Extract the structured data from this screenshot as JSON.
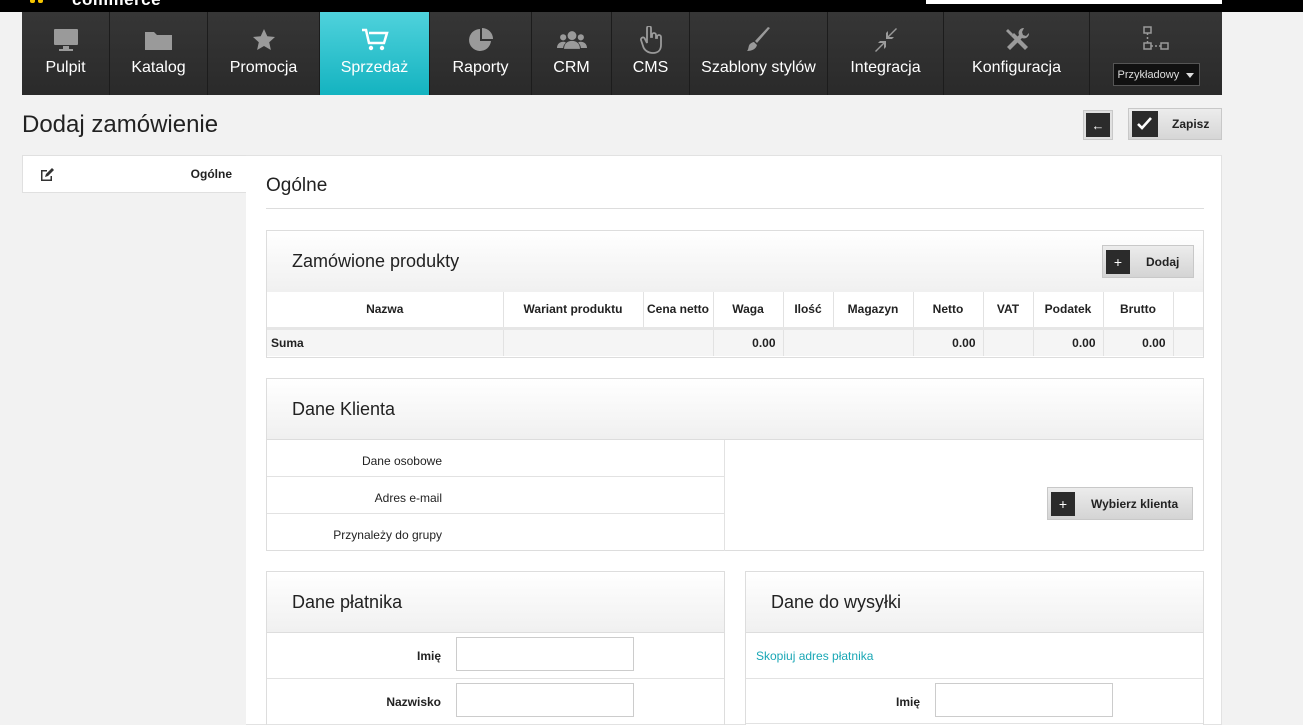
{
  "brand": {
    "text": "commerce",
    "accent": "#f5c400"
  },
  "nav": {
    "items": [
      {
        "label": "Pulpit",
        "icon": "monitor-icon"
      },
      {
        "label": "Katalog",
        "icon": "folder-icon"
      },
      {
        "label": "Promocja",
        "icon": "star-icon"
      },
      {
        "label": "Sprzedaż",
        "icon": "cart-icon",
        "active": true
      },
      {
        "label": "Raporty",
        "icon": "pie-chart-icon"
      },
      {
        "label": "CRM",
        "icon": "users-icon"
      },
      {
        "label": "CMS",
        "icon": "pointer-hand-icon"
      },
      {
        "label": "Szablony stylów",
        "icon": "brush-icon"
      },
      {
        "label": "Integracja",
        "icon": "compress-arrows-icon"
      },
      {
        "label": "Konfiguracja",
        "icon": "tools-icon"
      }
    ],
    "store_select": {
      "value": "Przykładowy",
      "icon": "sitemap-icon"
    },
    "active_color": "#1fb7c3"
  },
  "header": {
    "title": "Dodaj zamówienie",
    "back_icon": "arrow-left-icon",
    "save_label": "Zapisz"
  },
  "sidebar": {
    "tabs": [
      {
        "label": "Ogólne",
        "icon": "edit-icon"
      }
    ]
  },
  "main": {
    "section_title": "Ogólne",
    "products": {
      "title": "Zamówione produkty",
      "add_label": "Dodaj",
      "columns": [
        "Nazwa",
        "Wariant produktu",
        "Cena netto",
        "Waga",
        "Ilość",
        "Magazyn",
        "Netto",
        "VAT",
        "Podatek",
        "Brutto",
        ""
      ],
      "summary": {
        "label": "Suma",
        "waga": "0.00",
        "netto": "0.00",
        "podatek": "0.00",
        "brutto": "0.00"
      }
    },
    "client": {
      "title": "Dane Klienta",
      "rows": [
        "Dane osobowe",
        "Adres e-mail",
        "Przynależy do grupy"
      ],
      "select_label": "Wybierz klienta"
    },
    "payer": {
      "title": "Dane płatnika",
      "fields": [
        {
          "label": "Imię",
          "value": ""
        },
        {
          "label": "Nazwisko",
          "value": ""
        }
      ]
    },
    "shipping": {
      "title": "Dane do wysyłki",
      "copy_link": "Skopiuj adres płatnika",
      "fields": [
        {
          "label": "Imię",
          "value": ""
        }
      ]
    }
  }
}
